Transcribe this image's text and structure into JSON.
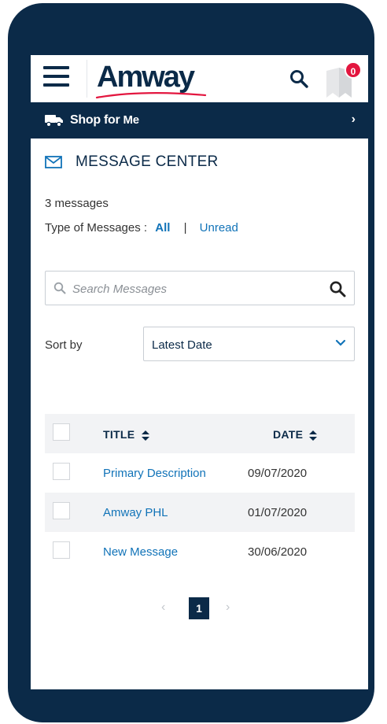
{
  "header": {
    "logo_text": "Amway",
    "notification_count": "0"
  },
  "shop_bar": {
    "label_prefix": "Shop for",
    "label_suffix": "Me"
  },
  "message_center": {
    "title": "MESSAGE CENTER",
    "count_text": "3 messages",
    "type_label": "Type of Messages :",
    "filter_all": "All",
    "filter_separator": "|",
    "filter_unread": "Unread"
  },
  "search": {
    "placeholder": "Search Messages"
  },
  "sort": {
    "label": "Sort by",
    "selected": "Latest Date"
  },
  "table": {
    "columns": [
      "TITLE",
      "DATE"
    ],
    "rows": [
      {
        "title": "Primary Description",
        "date": "09/07/2020"
      },
      {
        "title": "Amway PHL",
        "date": "01/07/2020"
      },
      {
        "title": "New Message",
        "date": "30/06/2020"
      }
    ]
  },
  "pagination": {
    "current_page": "1"
  },
  "colors": {
    "brand_navy": "#0b2a48",
    "link_blue": "#1173b8",
    "badge_red": "#e3163f"
  }
}
